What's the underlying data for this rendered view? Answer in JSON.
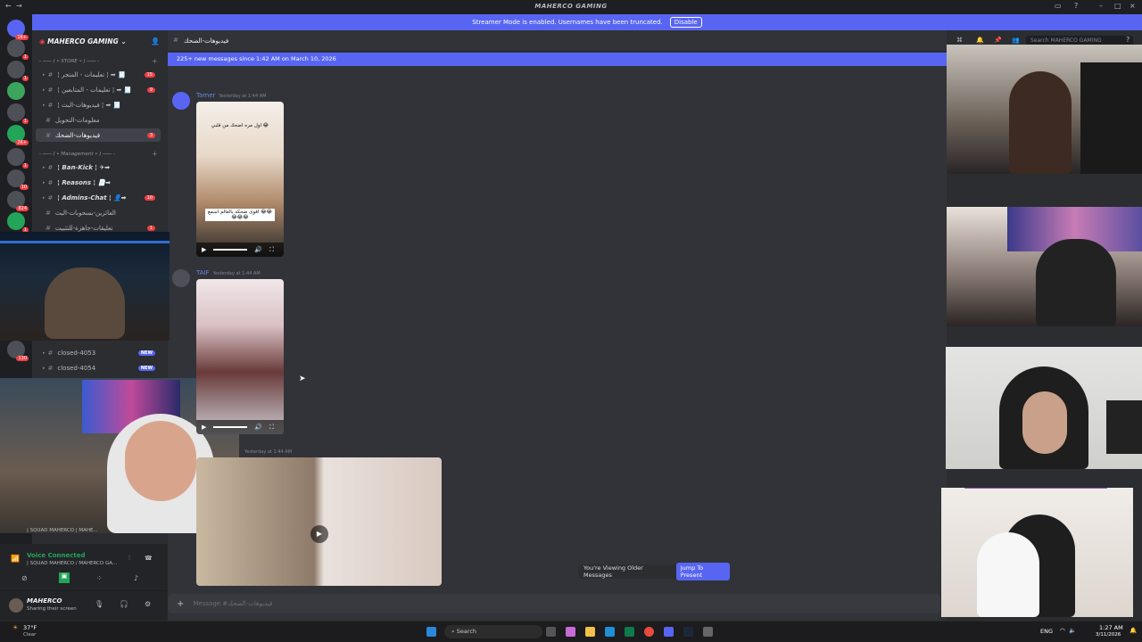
{
  "window": {
    "title": "MAHERCO GAMING"
  },
  "banner": {
    "text": "Streamer Mode is enabled. Usernames have been truncated.",
    "disable_label": "Disable"
  },
  "server": {
    "name": "MAHERCO GAMING"
  },
  "sidebar": {
    "category_store": "- ─── ( • STORE • ) ─── -",
    "category_management": "- ─── ( • Management • ) ─── -",
    "channels": [
      {
        "label": "¦ تعليمات - المتجر ¦ ➡ 🧾",
        "count": "15"
      },
      {
        "label": "¦ تعليمات - المتابعين ¦ ➡ 🧾",
        "count": "9"
      },
      {
        "label": "¦ فيديوهات-البث ¦ ➡ 🧾",
        "count": ""
      },
      {
        "label": "معلومات-التحويل",
        "count": ""
      },
      {
        "label": "فيديوهات-الضحك",
        "count": "3"
      },
      {
        "label": "¦ Ban-Kick ¦ ✈➡",
        "count": ""
      },
      {
        "label": "¦ Reasons ¦ 📄➡",
        "count": ""
      },
      {
        "label": "¦ Admins-Chat ¦ 👤➡",
        "count": "10"
      },
      {
        "label": "الفائزين-بسحوبات-البث",
        "count": ""
      },
      {
        "label": "تعليقات-جاهزة-للتثبيت",
        "count": "1"
      },
      {
        "label": "closed-4053",
        "new": "NEW"
      },
      {
        "label": "closed-4054",
        "new": "NEW"
      }
    ]
  },
  "server_badges": [
    "1K+",
    "1",
    "1",
    "1",
    "2K+",
    "1",
    "10",
    "824",
    "1",
    "130"
  ],
  "voice": {
    "status": "Voice Connected",
    "channel": "| SQUAD MAHERCO / MAHERCO GA...",
    "stream": "| SQUAD MAHERCO | MAHE..."
  },
  "user": {
    "name": "MAHERCO",
    "status": "Sharing their screen"
  },
  "chat": {
    "channel_name": "فيديوهات-الضحك",
    "new_messages_bar": "225+ new messages since 1:42 AM on March 10, 2026",
    "messages": [
      {
        "author": "Tamer",
        "time": "Yesterday at 1:44 AM",
        "video_caption_top": "اول مره اضحك من قلبي 😂",
        "video_caption_bottom": "اقوى ضحكه بالعالم اسمع 😂😂😂😂😂"
      },
      {
        "author": "TAIF",
        "time": "Yesterday at 1:44 AM"
      },
      {
        "author": "",
        "time": "Yesterday at 1:44 AM"
      }
    ],
    "older_notice": "You're Viewing Older Messages",
    "jump_label": "Jump To Present",
    "composer_placeholder": "Message #فيديوهات-الضحك"
  },
  "right_panel": {
    "search_placeholder": "Search MAHERCO GAMING"
  },
  "taskbar": {
    "weather_temp": "37°F",
    "weather_text": "Clear",
    "search_label": "Search",
    "lang": "ENG",
    "time": "1:27 AM",
    "date": "3/11/2026"
  },
  "colors": {
    "blurple": "#5865f2",
    "red_badge": "#f23f43",
    "bg_chat": "#313338",
    "bg_sidebar": "#2b2d31"
  }
}
